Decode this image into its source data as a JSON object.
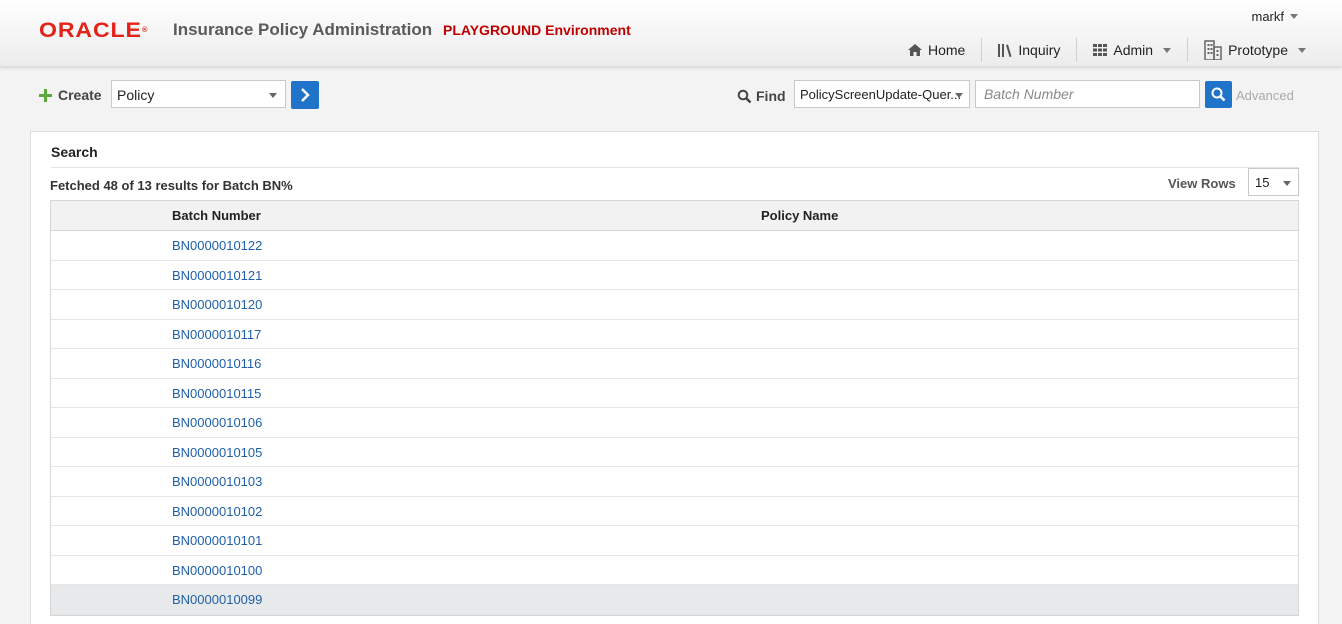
{
  "header": {
    "logo": "ORACLE",
    "app_title": "Insurance Policy Administration",
    "environment": "PLAYGROUND Environment",
    "user": "markf",
    "nav": [
      {
        "label": "Home",
        "icon": "home-icon"
      },
      {
        "label": "Inquiry",
        "icon": "library-icon"
      },
      {
        "label": "Admin",
        "icon": "grid-icon",
        "dropdown": true
      },
      {
        "label": "Prototype",
        "icon": "building-icon",
        "dropdown": true
      }
    ]
  },
  "toolbar": {
    "create_label": "Create",
    "create_type": "Policy",
    "find_label": "Find",
    "find_value": "PolicyScreenUpdate-Quer...",
    "batch_placeholder": "Batch Number",
    "advanced_label": "Advanced"
  },
  "search": {
    "title": "Search",
    "fetched_text": "Fetched 48 of 13 results for Batch BN%",
    "view_rows_label": "View Rows",
    "view_rows_value": "15",
    "columns": [
      "Batch Number",
      "Policy Name"
    ],
    "rows": [
      {
        "batch": "BN0000010122",
        "policy": ""
      },
      {
        "batch": "BN0000010121",
        "policy": ""
      },
      {
        "batch": "BN0000010120",
        "policy": ""
      },
      {
        "batch": "BN0000010117",
        "policy": ""
      },
      {
        "batch": "BN0000010116",
        "policy": ""
      },
      {
        "batch": "BN0000010115",
        "policy": ""
      },
      {
        "batch": "BN0000010106",
        "policy": ""
      },
      {
        "batch": "BN0000010105",
        "policy": ""
      },
      {
        "batch": "BN0000010103",
        "policy": ""
      },
      {
        "batch": "BN0000010102",
        "policy": ""
      },
      {
        "batch": "BN0000010101",
        "policy": ""
      },
      {
        "batch": "BN0000010100",
        "policy": ""
      },
      {
        "batch": "BN0000010099",
        "policy": ""
      }
    ]
  },
  "colors": {
    "brand_red": "#e2231a",
    "env_red": "#c00000",
    "accent_blue": "#1f73c8",
    "link_blue": "#1f5fa8"
  }
}
